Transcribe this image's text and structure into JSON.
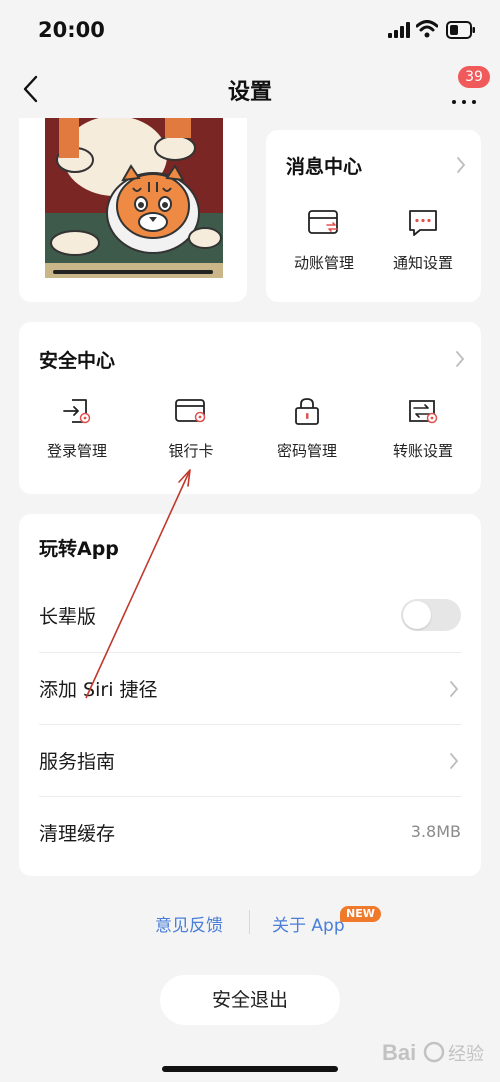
{
  "status_bar": {
    "time": "20:00"
  },
  "nav": {
    "title": "设置",
    "badge_count": "39"
  },
  "message_center": {
    "title": "消息中心",
    "items": [
      {
        "label": "动账管理",
        "icon": "card-transfer-icon"
      },
      {
        "label": "通知设置",
        "icon": "chat-bubble-icon"
      }
    ]
  },
  "security_center": {
    "title": "安全中心",
    "items": [
      {
        "label": "登录管理",
        "icon": "login-icon"
      },
      {
        "label": "银行卡",
        "icon": "bank-card-icon"
      },
      {
        "label": "密码管理",
        "icon": "lock-icon"
      },
      {
        "label": "转账设置",
        "icon": "transfer-icon"
      }
    ]
  },
  "play_app": {
    "title": "玩转App",
    "rows": [
      {
        "label": "长辈版",
        "control": "toggle",
        "on": false
      },
      {
        "label": "添加 Siri 捷径",
        "control": "chevron"
      },
      {
        "label": "服务指南",
        "control": "chevron"
      },
      {
        "label": "清理缓存",
        "value": "3.8MB"
      }
    ]
  },
  "footer": {
    "feedback": "意见反馈",
    "about": "关于 App",
    "new_badge": "NEW",
    "logout": "安全退出"
  },
  "watermark": {
    "text": "Bai 经验"
  },
  "colors": {
    "accent_blue": "#4a7ed8",
    "badge_red": "#f05a5a",
    "new_orange": "#f07a2c",
    "icon_red": "#e0524d"
  }
}
